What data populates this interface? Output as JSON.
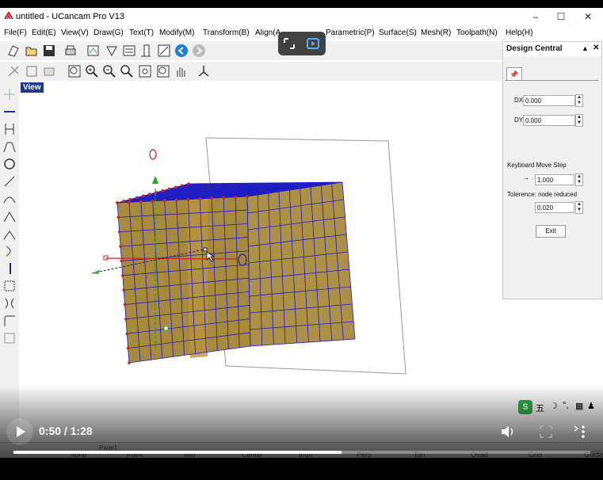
{
  "window": {
    "title": "untitled - UCancam Pro V13",
    "minimize": "–",
    "maximize": "☐",
    "close": "✕"
  },
  "menu": [
    "File(F)",
    "Edit(E)",
    "View(V)",
    "Draw(G)",
    "Text(T)",
    "Modify(M)",
    "Transform(B)",
    "Align(A",
    "Parametric(P)",
    "Surface(S)",
    "Mesh(R)",
    "Toolpath(N)",
    "Help(H)"
  ],
  "canvas": {
    "view_label": "View"
  },
  "design_central": {
    "title": "Design Central",
    "tab_icon": "pin-icon",
    "dx_label": "DX",
    "dx_value": "0.000",
    "dy_label": "DY",
    "dy_value": "0.000",
    "keyboard_move_step_label": "Keyboard Move Step",
    "keyboard_move_step_arrow": "→",
    "keyboard_move_step_value": "1.000",
    "tolerance_label": "Tolerence: node reduced",
    "tolerance_value": "0.020",
    "exit_label": "Exit"
  },
  "statusbar": {
    "page_tab": "Page1",
    "items": [
      "None",
      "Point",
      "Mid",
      "Center",
      "Inter",
      "Perp",
      "Tan",
      "Quad",
      "Grid",
      "Guide"
    ]
  },
  "video": {
    "time": "0:50 / 1:28",
    "progress": 0.568
  },
  "ime": {
    "glyph": "五",
    "logo": "S"
  },
  "colors": {
    "cube_face": "#a88a3c",
    "cube_top": "#2a2ab0",
    "mesh_line": "#1a1acc",
    "node": "#cc2222",
    "menu_bg": "#ffffff",
    "toolbar_bg": "#f0f0f0"
  }
}
